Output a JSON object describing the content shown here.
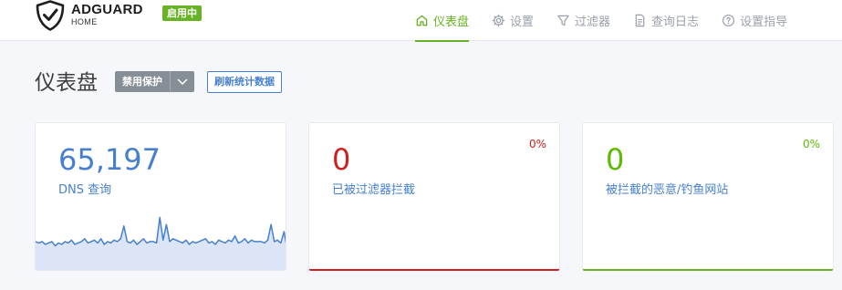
{
  "app": {
    "logo_title": "ADGUARD",
    "logo_subtitle": "HOME",
    "status_badge": "启用中",
    "brand_color": "#67b324"
  },
  "nav": {
    "items": [
      {
        "label": "仪表盘",
        "icon": "home-icon",
        "active": true
      },
      {
        "label": "设置",
        "icon": "gear-icon",
        "active": false
      },
      {
        "label": "过滤器",
        "icon": "filter-icon",
        "active": false
      },
      {
        "label": "查询日志",
        "icon": "document-icon",
        "active": false
      },
      {
        "label": "设置指导",
        "icon": "help-circle-icon",
        "active": false
      }
    ]
  },
  "page": {
    "title": "仪表盘",
    "disable_protection_label": "禁用保护",
    "refresh_label": "刷新统计数据"
  },
  "cards": [
    {
      "value": "65,197",
      "label": "DNS 查询",
      "percent": "",
      "color": "#467fcf"
    },
    {
      "value": "0",
      "label": "已被过滤器拦截",
      "percent": "0%",
      "color": "#cd201f"
    },
    {
      "value": "0",
      "label": "被拦截的恶意/钓鱼网站",
      "percent": "0%",
      "color": "#5eba00"
    }
  ],
  "chart_data": {
    "type": "area",
    "series": [
      {
        "values": [
          20,
          19,
          20,
          18,
          19,
          20,
          17,
          19,
          18,
          20,
          19,
          21,
          18,
          19,
          20,
          22,
          19,
          20,
          21,
          19,
          22,
          18,
          20,
          19,
          21,
          20,
          22,
          31,
          20,
          19,
          21,
          18,
          20,
          22,
          19,
          20,
          20,
          19,
          37,
          21,
          32,
          20,
          22,
          21,
          20,
          19,
          21,
          18,
          20,
          19,
          20,
          21,
          22,
          19,
          20,
          18,
          21,
          20,
          19,
          21,
          20,
          24,
          19,
          20,
          22,
          19,
          21,
          20,
          20,
          20,
          19,
          21,
          32,
          20,
          21,
          19,
          27,
          14
        ]
      }
    ]
  }
}
